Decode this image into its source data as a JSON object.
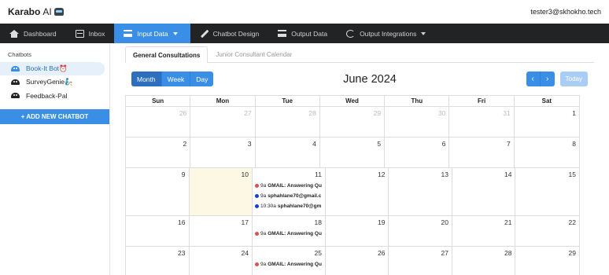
{
  "app": {
    "brand": "Karabo",
    "brand_suffix": "AI",
    "user_email": "tester3@skhokho.tech"
  },
  "nav": [
    {
      "label": "Dashboard",
      "icon": "home-icon"
    },
    {
      "label": "Inbox",
      "icon": "inbox-icon"
    },
    {
      "label": "Input Data",
      "icon": "list-icon",
      "active": true
    },
    {
      "label": "Chatbot Design",
      "icon": "brush-icon"
    },
    {
      "label": "Output Data",
      "icon": "table-icon"
    },
    {
      "label": "Output Integrations",
      "icon": "sync-icon"
    }
  ],
  "sidebar": {
    "heading": "Chatbots",
    "items": [
      {
        "label": "Book-It Bot⏰",
        "color": "#3a8ee6"
      },
      {
        "label": "SurveyGenie🧞",
        "color": "#222222"
      },
      {
        "label": "Feedback-Pal",
        "color": "#222222"
      }
    ],
    "add_label": "+ ADD NEW CHATBOT"
  },
  "tabs": [
    "General Consultations",
    "Junior Consultant Calendar"
  ],
  "calendar": {
    "title": "June 2024",
    "views": [
      "Month",
      "Week",
      "Day"
    ],
    "prev": "‹",
    "next": "›",
    "today_label": "Today",
    "weekdays": [
      "Sun",
      "Mon",
      "Tue",
      "Wed",
      "Thu",
      "Fri",
      "Sat"
    ],
    "weeks": [
      [
        {
          "n": "26",
          "other": true
        },
        {
          "n": "27",
          "other": true
        },
        {
          "n": "28",
          "other": true
        },
        {
          "n": "29",
          "other": true
        },
        {
          "n": "30",
          "other": true
        },
        {
          "n": "31",
          "other": true
        },
        {
          "n": "1"
        }
      ],
      [
        {
          "n": "2"
        },
        {
          "n": "3"
        },
        {
          "n": "4"
        },
        {
          "n": "5"
        },
        {
          "n": "6"
        },
        {
          "n": "7"
        },
        {
          "n": "8"
        }
      ],
      [
        {
          "n": "9"
        },
        {
          "n": "10",
          "today": true
        },
        {
          "n": "11",
          "events": [
            {
              "time": "9a",
              "title": "GMAIL: Answering Qu",
              "color": "#d9534f"
            },
            {
              "time": "9a",
              "title": "sphahlane70@gmail.c",
              "color": "#1a3fcf"
            },
            {
              "time": "10:30a",
              "title": "sphahlane70@gm",
              "color": "#1a3fcf"
            }
          ]
        },
        {
          "n": "12"
        },
        {
          "n": "13"
        },
        {
          "n": "14"
        },
        {
          "n": "15"
        }
      ],
      [
        {
          "n": "16"
        },
        {
          "n": "17"
        },
        {
          "n": "18",
          "events": [
            {
              "time": "9a",
              "title": "GMAIL: Answering Qu",
              "color": "#d9534f"
            }
          ]
        },
        {
          "n": "19"
        },
        {
          "n": "20"
        },
        {
          "n": "21"
        },
        {
          "n": "22"
        }
      ],
      [
        {
          "n": "23"
        },
        {
          "n": "24"
        },
        {
          "n": "25",
          "events": [
            {
              "time": "9a",
              "title": "GMAIL: Answering Qu",
              "color": "#d9534f"
            }
          ]
        },
        {
          "n": "26"
        },
        {
          "n": "27"
        },
        {
          "n": "28"
        },
        {
          "n": "29"
        }
      ]
    ]
  }
}
